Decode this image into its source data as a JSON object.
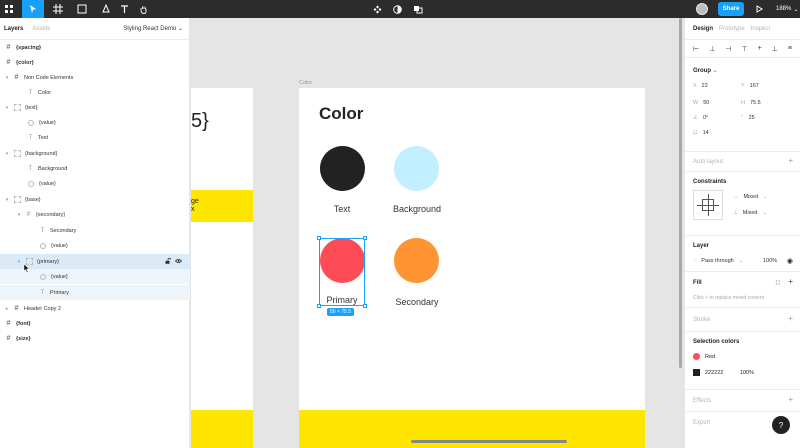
{
  "toolbar": {
    "share_label": "Share",
    "zoom_label": "188%"
  },
  "left_panel": {
    "tabs": [
      "Layers",
      "Assets"
    ],
    "page_name": "Styling React Demo",
    "layers": [
      {
        "name": "{spacing}"
      },
      {
        "name": "{color}"
      },
      {
        "name": "Non Code Elements"
      },
      {
        "name": "Color"
      },
      {
        "name": "{text}"
      },
      {
        "name": "{value}"
      },
      {
        "name": "Text"
      },
      {
        "name": "{background}"
      },
      {
        "name": "Background"
      },
      {
        "name": "{value}"
      },
      {
        "name": "{base}"
      },
      {
        "name": "{secondary}"
      },
      {
        "name": "Secondary"
      },
      {
        "name": "{value}"
      },
      {
        "name": "{primary}"
      },
      {
        "name": "{value}"
      },
      {
        "name": "Primary"
      },
      {
        "name": "Header Copy 2"
      },
      {
        "name": "{font}"
      },
      {
        "name": "{size}"
      }
    ]
  },
  "canvas": {
    "partial_text": "5}",
    "yellow_text_1": "ge",
    "yellow_text_2": "x",
    "frame_label": "Color",
    "frame_title": "Color",
    "swatches": [
      {
        "label": "Text",
        "color": "#222222"
      },
      {
        "label": "Background",
        "color": "#c2efff"
      },
      {
        "label": "Primary",
        "color": "#ff4b55"
      },
      {
        "label": "Secondary",
        "color": "#ff9433"
      }
    ],
    "selection_size": "50 × 75.5"
  },
  "right_panel": {
    "tabs": [
      "Design",
      "Prototype",
      "Inspect"
    ],
    "group": {
      "title": "Group",
      "x_label": "X",
      "x": "22",
      "y_label": "Y",
      "y": "167",
      "w_label": "W",
      "w": "50",
      "h_label": "H",
      "h": "75.5",
      "rotation": "0°",
      "radius": "25",
      "extra": "14"
    },
    "auto_layout": "Auto layout",
    "constraints": {
      "title": "Constraints",
      "h_value": "Mixed",
      "v_value": "Mixed"
    },
    "layer": {
      "title": "Layer",
      "blend": "Pass through",
      "opacity": "100%"
    },
    "fill": {
      "title": "Fill",
      "hint": "Click + to replace mixed content"
    },
    "stroke": "Stroke",
    "selection_colors": {
      "title": "Selection colors",
      "items": [
        {
          "name": "Red",
          "color": "#ff4b55",
          "opacity": ""
        },
        {
          "name": "222222",
          "color": "#222222",
          "opacity": "100%"
        }
      ]
    },
    "effects": "Effects",
    "export": "Export"
  },
  "help_label": "?"
}
